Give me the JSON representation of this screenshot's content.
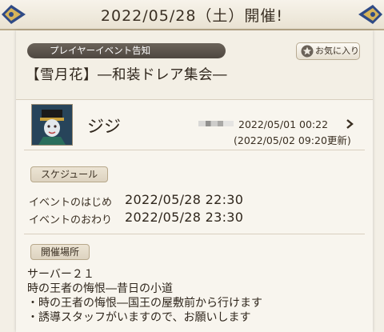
{
  "banner": {
    "title": "2022/05/28（土）開催!"
  },
  "header": {
    "category": "プレイヤーイベント告知",
    "favorite_label": "お気に入り",
    "event_title": "【雪月花】―和装ドレア集会―"
  },
  "author": {
    "name": "ジジ",
    "posted": "2022/05/01 00:22",
    "updated": "(2022/05/02 09:20更新)"
  },
  "schedule": {
    "section_label": "スケジュール",
    "start_label": "イベントのはじめ",
    "start_value": "2022/05/28 22:30",
    "end_label": "イベントのおわり",
    "end_value": "2022/05/28 23:30"
  },
  "location": {
    "section_label": "開催場所",
    "lines": [
      "サーバー２１",
      "時の王者の悔恨―昔日の小道",
      "・時の王者の悔恨―国王の屋敷前から行けます",
      "・誘導スタッフがいますので、お願いします"
    ]
  },
  "colors": {
    "accent": "#4e4740",
    "background": "#f3efe6",
    "panel": "#f8f5ee"
  },
  "icons": {
    "favorite": "star-icon",
    "open_detail": "chevron-right-icon",
    "corner": "ornament-icon"
  }
}
